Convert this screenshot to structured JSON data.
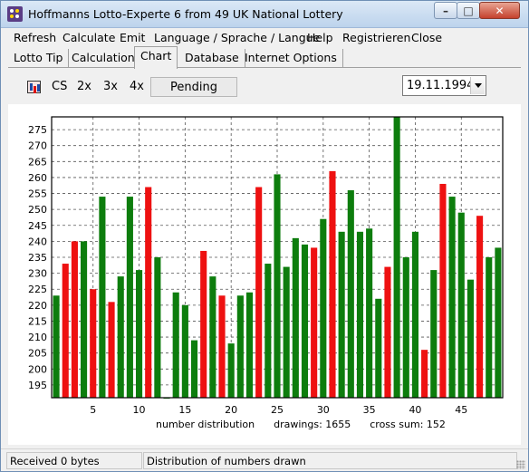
{
  "window": {
    "title": "Hoffmanns Lotto-Experte  6 from 49 UK National Lottery",
    "minimize_glyph": "–",
    "maximize_glyph": "□",
    "close_glyph": "✕"
  },
  "menu": [
    "Refresh",
    "Calculate",
    "Emit",
    "Language / Sprache / Langue",
    "Help",
    "Registrieren",
    "Close"
  ],
  "tabs": [
    {
      "label": "Lotto Tip",
      "active": false
    },
    {
      "label": "Calculation",
      "active": false
    },
    {
      "label": "Chart",
      "active": true
    },
    {
      "label": "Database",
      "active": false
    },
    {
      "label": "Internet Options",
      "active": false
    }
  ],
  "toolbar": {
    "icon": "bar-chart-icon",
    "buttons": [
      "CS",
      "2x",
      "3x",
      "4x"
    ],
    "pending_label": "Pending",
    "date_value": "19.11.1994"
  },
  "chart_data": {
    "type": "bar",
    "caption": "number distribution      drawings: 1655      cross sum: 152",
    "xlabel": "",
    "ylabel": "",
    "x_ticks": [
      5,
      10,
      15,
      20,
      25,
      30,
      35,
      40,
      45
    ],
    "y_ticks": [
      195,
      200,
      205,
      210,
      215,
      220,
      225,
      230,
      235,
      240,
      245,
      250,
      255,
      260,
      265,
      270,
      275
    ],
    "ylim": [
      191,
      279
    ],
    "grid": true,
    "categories": [
      1,
      2,
      3,
      4,
      5,
      6,
      7,
      8,
      9,
      10,
      11,
      12,
      13,
      14,
      15,
      16,
      17,
      18,
      19,
      20,
      21,
      22,
      23,
      24,
      25,
      26,
      27,
      28,
      29,
      30,
      31,
      32,
      33,
      34,
      35,
      36,
      37,
      38,
      39,
      40,
      41,
      42,
      43,
      44,
      45,
      46,
      47,
      48,
      49
    ],
    "values": [
      223,
      233,
      240,
      240,
      225,
      254,
      221,
      229,
      254,
      231,
      257,
      235,
      191,
      224,
      220,
      209,
      237,
      229,
      223,
      208,
      223,
      224,
      257,
      233,
      261,
      232,
      241,
      239,
      238,
      247,
      262,
      243,
      256,
      243,
      244,
      222,
      232,
      279,
      235,
      243,
      206,
      231,
      258,
      254,
      249,
      228,
      248,
      235,
      238
    ],
    "highlighted": [
      2,
      3,
      5,
      7,
      11,
      17,
      19,
      23,
      29,
      31,
      37,
      41,
      43,
      47
    ],
    "colors": {
      "highlight": "#ee1111",
      "normal": "#0d7d0d"
    }
  },
  "status": {
    "left": "Received 0 bytes",
    "right": "Distribution of numbers drawn"
  }
}
